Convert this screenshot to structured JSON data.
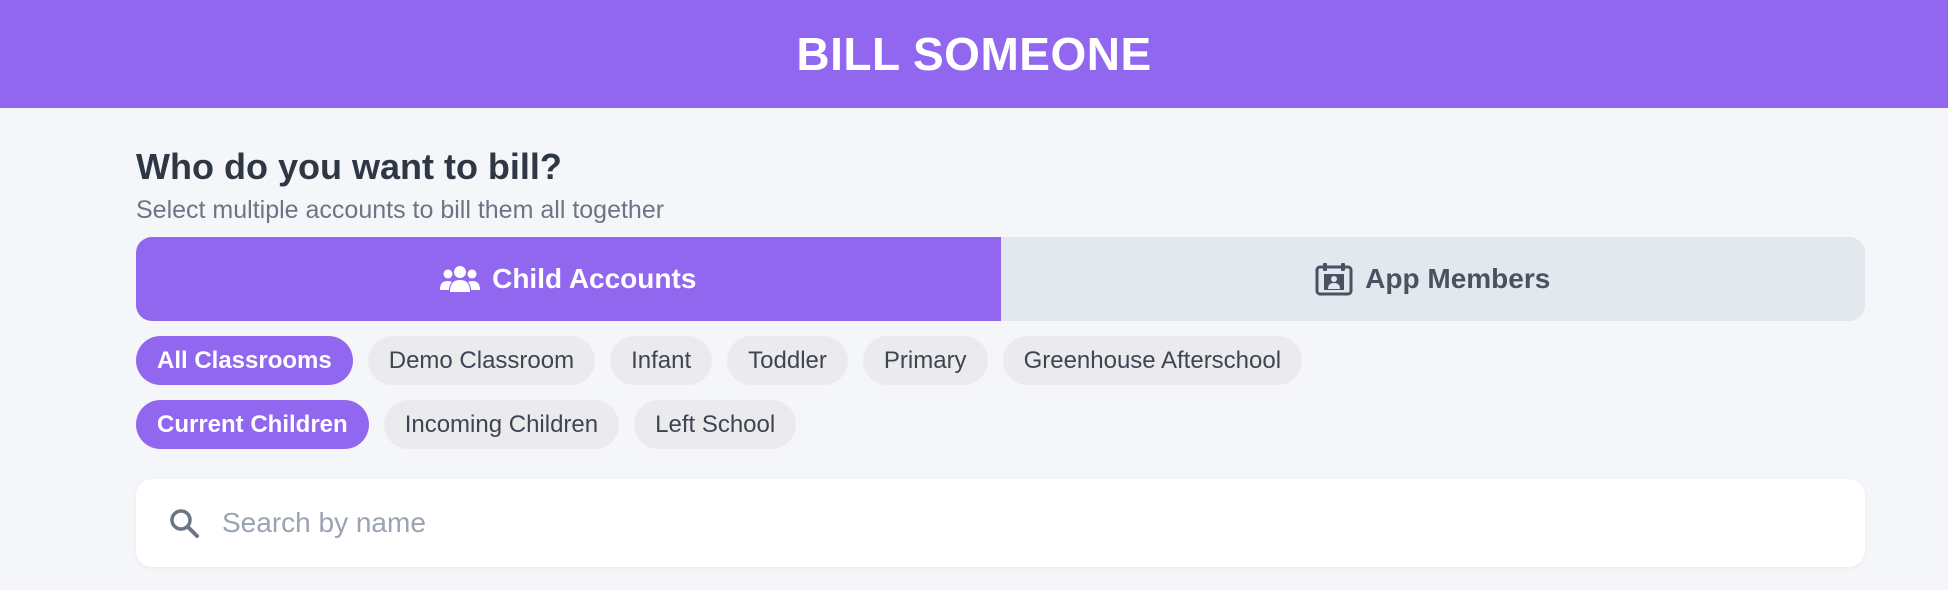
{
  "header": {
    "title": "BILL SOMEONE"
  },
  "prompt": {
    "question": "Who do you want to bill?",
    "subtitle": "Select multiple accounts to bill them all together"
  },
  "account_toggle": {
    "options": [
      {
        "label": "Child Accounts",
        "icon": "users-icon",
        "selected": true
      },
      {
        "label": "App Members",
        "icon": "calendar-person-icon",
        "selected": false
      }
    ]
  },
  "classroom_filters": [
    {
      "label": "All Classrooms",
      "selected": true
    },
    {
      "label": "Demo Classroom",
      "selected": false
    },
    {
      "label": "Infant",
      "selected": false
    },
    {
      "label": "Toddler",
      "selected": false
    },
    {
      "label": "Primary",
      "selected": false
    },
    {
      "label": "Greenhouse Afterschool",
      "selected": false
    }
  ],
  "status_filters": [
    {
      "label": "Current Children",
      "selected": true
    },
    {
      "label": "Incoming Children",
      "selected": false
    },
    {
      "label": "Left School",
      "selected": false
    }
  ],
  "search": {
    "placeholder": "Search by name",
    "value": "",
    "icon": "search-icon"
  },
  "colors": {
    "accent": "#9067ee",
    "background": "#f5f6f9",
    "chip": "#ebebee",
    "toggle_inactive": "#e3e7ee"
  }
}
